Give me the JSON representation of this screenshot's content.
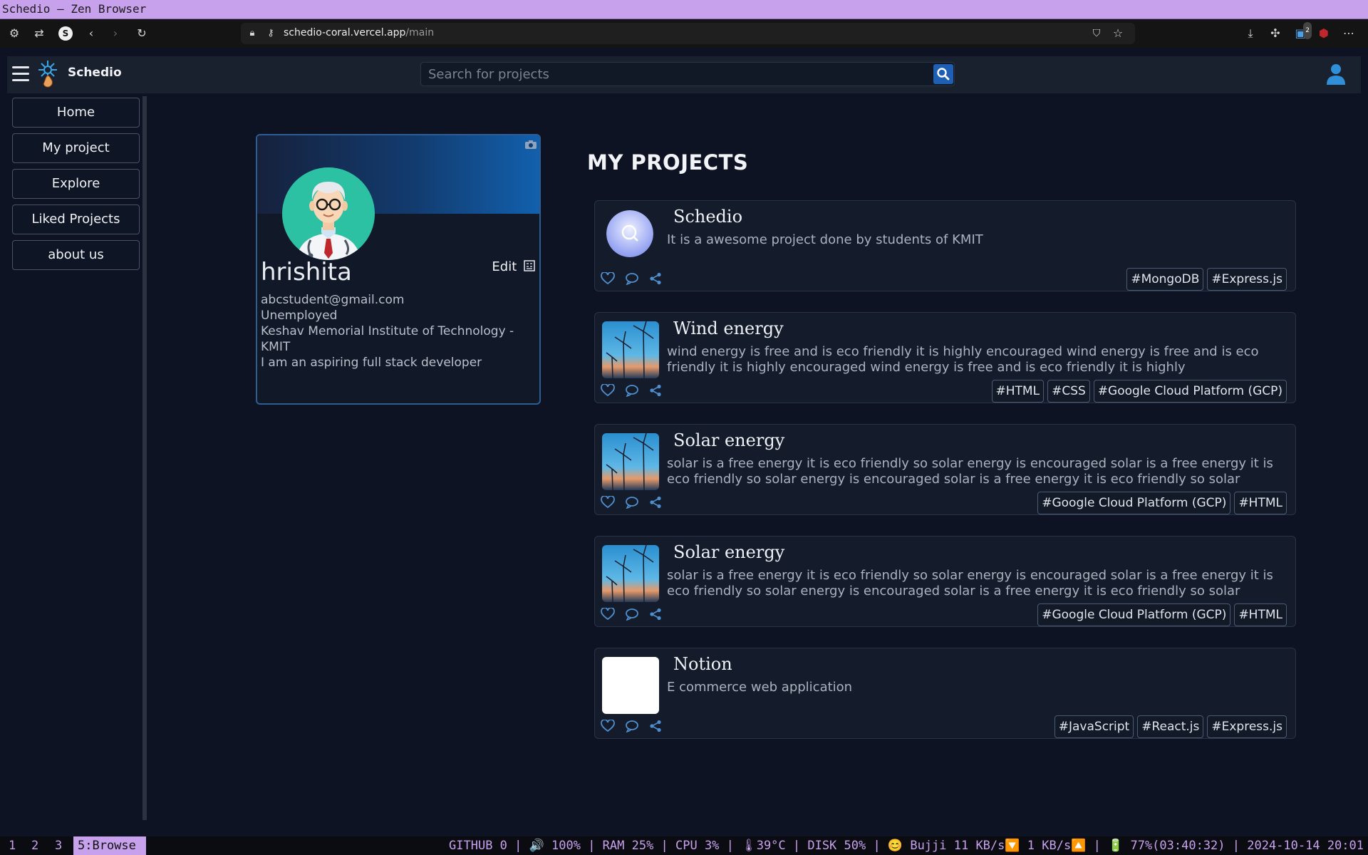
{
  "window": {
    "title": "Schedio — Zen Browser"
  },
  "browser": {
    "url_host": "schedio-coral.vercel.app",
    "url_path": "/main",
    "extension_badge": "2"
  },
  "app": {
    "brand": "Schedio",
    "search": {
      "placeholder": "Search for projects",
      "value": ""
    }
  },
  "sidebar": {
    "items": [
      {
        "label": "Home"
      },
      {
        "label": "My project"
      },
      {
        "label": "Explore"
      },
      {
        "label": "Liked Projects"
      },
      {
        "label": "about us"
      }
    ]
  },
  "profile": {
    "name": "hrishita",
    "edit_label": "Edit",
    "email": "abcstudent@gmail.com",
    "status": "Unemployed",
    "institute": "Keshav Memorial Institute of Technology - KMIT",
    "bio": "I am an aspiring full stack developer"
  },
  "projects_section": {
    "title": "MY PROJECTS",
    "projects": [
      {
        "title": "Schedio",
        "desc": "It is a awesome project done by students of KMIT",
        "thumb": "logo",
        "tags": [
          "#MongoDB",
          "#Express.js"
        ]
      },
      {
        "title": "Wind energy",
        "desc": "wind energy is free and is eco friendly it is highly encouraged wind energy is free and is eco friendly it is highly encouraged wind energy is free and is eco friendly it is highly",
        "thumb": "turbines",
        "tags": [
          "#HTML",
          "#CSS",
          "#Google Cloud Platform (GCP)"
        ]
      },
      {
        "title": "Solar energy",
        "desc": "solar is a free energy it is eco friendly so solar energy is encouraged solar is a free energy it is eco friendly so solar energy is encouraged solar is a free energy it is eco friendly so solar",
        "thumb": "turbines",
        "tags": [
          "#Google Cloud Platform (GCP)",
          "#HTML"
        ]
      },
      {
        "title": "Solar energy",
        "desc": "solar is a free energy it is eco friendly so solar energy is encouraged solar is a free energy it is eco friendly so solar energy is encouraged solar is a free energy it is eco friendly so solar",
        "thumb": "turbines",
        "tags": [
          "#Google Cloud Platform (GCP)",
          "#HTML"
        ]
      },
      {
        "title": "Notion",
        "desc": "E commerce web application",
        "thumb": "blank",
        "tags": [
          "#JavaScript",
          "#React.js",
          "#Express.js"
        ]
      }
    ]
  },
  "statusbar": {
    "workspaces": [
      "1",
      "2",
      "3"
    ],
    "active_workspace": "5:Browse",
    "system": "GITHUB 0 | 🔊 100% | RAM 25% | CPU 3% | 🌡39°C | DISK 50% | 😊 Bujji 11 KB/s🔽 1 KB/s🔼 | 🔋 77%(03:40:32) | 2024-10-14 20:01"
  },
  "colors": {
    "accent": "#1f5fb3",
    "titlebar": "#c7a1ec",
    "background": "#0d1322"
  }
}
